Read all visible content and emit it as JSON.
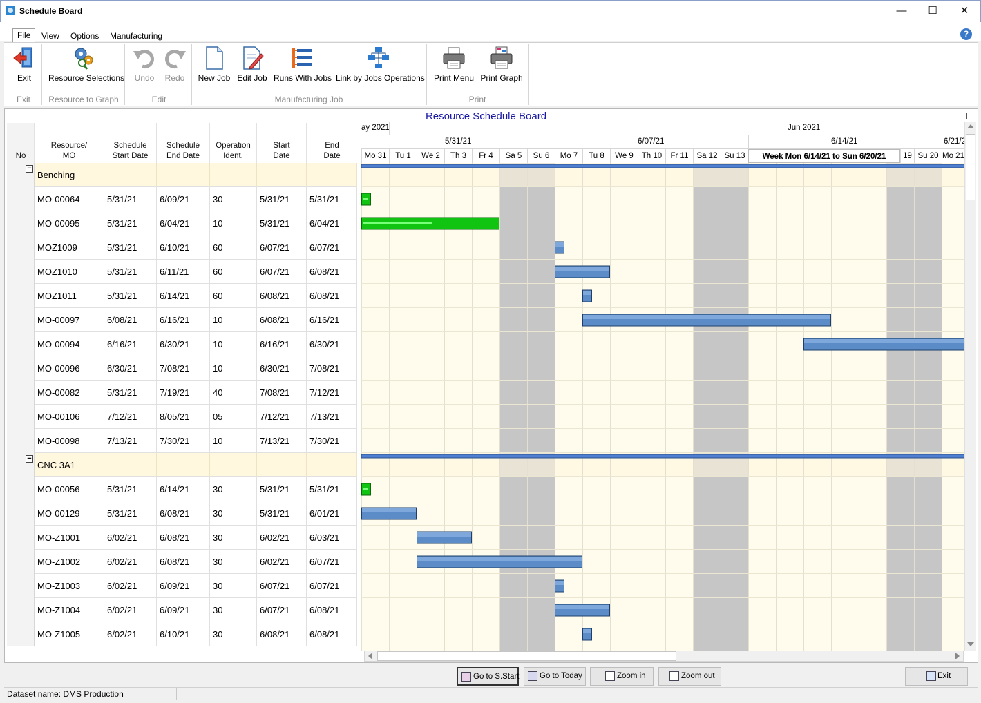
{
  "window": {
    "title": "Schedule Board",
    "minimize": "—",
    "maximize": "☐",
    "close": "✕"
  },
  "menu": {
    "file": "File",
    "view": "View",
    "options": "Options",
    "manufacturing": "Manufacturing",
    "help": "?"
  },
  "ribbon": {
    "exit": "Exit",
    "resource_selections": "Resource Selections",
    "undo": "Undo",
    "redo": "Redo",
    "new_job": "New Job",
    "edit_job": "Edit Job",
    "runs_with_jobs": "Runs With Jobs",
    "link_by_jobs_operations": "Link by Jobs Operations",
    "print_menu": "Print Menu",
    "print_graph": "Print Graph",
    "groups": {
      "exit": "Exit",
      "resource_to_graph": "Resource to Graph",
      "edit": "Edit",
      "manufacturing_job": "Manufacturing Job",
      "print": "Print"
    }
  },
  "board": {
    "title": "Resource Schedule Board",
    "columns": {
      "no": "No",
      "resource_a": "Resource/",
      "resource_b": "MO",
      "sched_start_a": "Schedule",
      "sched_start_b": "Start Date",
      "sched_end_a": "Schedule",
      "sched_end_b": "End Date",
      "op_a": "Operation",
      "op_b": "Ident.",
      "start_a": "Start",
      "start_b": "Date",
      "end_a": "End",
      "end_b": "Date"
    },
    "timeline": {
      "month_left": "ay 2021",
      "month_right": "Jun 2021",
      "weeks": [
        "5/31/21",
        "6/07/21",
        "6/14/21",
        "6/21/2"
      ],
      "week_highlight": "Week Mon 6/14/21 to  Sun 6/20/21",
      "days_a": [
        "Mo 31",
        "Tu 1",
        "We 2",
        "Th 3",
        "Fr 4",
        "Sa 5",
        "Su 6",
        "Mo 7",
        "Tu 8",
        "We 9",
        "Th 10",
        "Fr 11",
        "Sa 12",
        "Su 13"
      ],
      "days_b": [
        "19",
        "Su 20",
        "Mo 21"
      ]
    },
    "rows": [
      {
        "type": "group",
        "name": "Benching",
        "toggle": "−"
      },
      {
        "mo": "MO-00064",
        "ss": "5/31/21",
        "se": "6/09/21",
        "op": "30",
        "st": "5/31/21",
        "en": "5/31/21"
      },
      {
        "mo": "MO-00095",
        "ss": "5/31/21",
        "se": "6/04/21",
        "op": "10",
        "st": "5/31/21",
        "en": "6/04/21"
      },
      {
        "mo": "MOZ1009",
        "ss": "5/31/21",
        "se": "6/10/21",
        "op": "60",
        "st": "6/07/21",
        "en": "6/07/21"
      },
      {
        "mo": "MOZ1010",
        "ss": "5/31/21",
        "se": "6/11/21",
        "op": "60",
        "st": "6/07/21",
        "en": "6/08/21"
      },
      {
        "mo": "MOZ1011",
        "ss": "5/31/21",
        "se": "6/14/21",
        "op": "60",
        "st": "6/08/21",
        "en": "6/08/21"
      },
      {
        "mo": "MO-00097",
        "ss": "6/08/21",
        "se": "6/16/21",
        "op": "10",
        "st": "6/08/21",
        "en": "6/16/21"
      },
      {
        "mo": "MO-00094",
        "ss": "6/16/21",
        "se": "6/30/21",
        "op": "10",
        "st": "6/16/21",
        "en": "6/30/21"
      },
      {
        "mo": "MO-00096",
        "ss": "6/30/21",
        "se": "7/08/21",
        "op": "10",
        "st": "6/30/21",
        "en": "7/08/21"
      },
      {
        "mo": "MO-00082",
        "ss": "5/31/21",
        "se": "7/19/21",
        "op": "40",
        "st": "7/08/21",
        "en": "7/12/21"
      },
      {
        "mo": "MO-00106",
        "ss": "7/12/21",
        "se": "8/05/21",
        "op": "05",
        "st": "7/12/21",
        "en": "7/13/21"
      },
      {
        "mo": "MO-00098",
        "ss": "7/13/21",
        "se": "7/30/21",
        "op": "10",
        "st": "7/13/21",
        "en": "7/30/21"
      },
      {
        "type": "group",
        "name": "CNC 3A1",
        "toggle": "−"
      },
      {
        "mo": "MO-00056",
        "ss": "5/31/21",
        "se": "6/14/21",
        "op": "30",
        "st": "5/31/21",
        "en": "5/31/21"
      },
      {
        "mo": "MO-00129",
        "ss": "5/31/21",
        "se": "6/08/21",
        "op": "30",
        "st": "5/31/21",
        "en": "6/01/21"
      },
      {
        "mo": "MO-Z1001",
        "ss": "6/02/21",
        "se": "6/08/21",
        "op": "30",
        "st": "6/02/21",
        "en": "6/03/21"
      },
      {
        "mo": "MO-Z1002",
        "ss": "6/02/21",
        "se": "6/08/21",
        "op": "30",
        "st": "6/02/21",
        "en": "6/07/21"
      },
      {
        "mo": "MO-Z1003",
        "ss": "6/02/21",
        "se": "6/09/21",
        "op": "30",
        "st": "6/07/21",
        "en": "6/07/21"
      },
      {
        "mo": "MO-Z1004",
        "ss": "6/02/21",
        "se": "6/09/21",
        "op": "30",
        "st": "6/07/21",
        "en": "6/08/21"
      },
      {
        "mo": "MO-Z1005",
        "ss": "6/02/21",
        "se": "6/10/21",
        "op": "30",
        "st": "6/08/21",
        "en": "6/08/21"
      }
    ]
  },
  "bottom": {
    "go_to_sstart": "Go to S.Start",
    "go_to_today": "Go to Today",
    "zoom_in": "Zoom in",
    "zoom_out": "Zoom out",
    "exit": "Exit"
  },
  "status": {
    "dataset": "Dataset name:  DMS Production"
  },
  "colors": {
    "bar_blue": "#5b8cc8",
    "bar_green": "#12c412",
    "weekend": "#c6c6c6",
    "weekday": "#fffcee",
    "group_row": "#fff7de",
    "title": "#1a1aa6"
  }
}
